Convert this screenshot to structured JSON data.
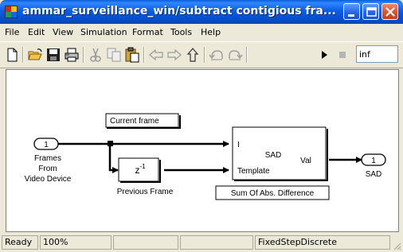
{
  "window": {
    "title": "ammar_surveillance_win/subtract contigious fra...",
    "title_icon": "simulink-model-icon",
    "buttons": [
      "minimize-icon",
      "maximize-icon",
      "close-icon"
    ]
  },
  "menu": {
    "items": [
      "File",
      "Edit",
      "View",
      "Simulation",
      "Format",
      "Tools",
      "Help"
    ]
  },
  "toolbar": {
    "icons": [
      "new-icon",
      "open-icon",
      "save-icon",
      "print-icon",
      "cut-icon",
      "copy-icon",
      "paste-icon",
      "back-icon",
      "forward-icon",
      "up-icon",
      "undo-icon",
      "redo-icon",
      "start-simulation-icon",
      "stop-simulation-icon"
    ],
    "stop_time": "inf"
  },
  "diagram": {
    "inport": {
      "number": "1",
      "label_lines": [
        "Frames",
        "From",
        "Video Device"
      ]
    },
    "current_frame_label": "Current frame",
    "delay": {
      "label": "Previous Frame"
    },
    "sad_block": {
      "title": "SAD",
      "in1": "I",
      "in2": "Template",
      "out": "Val",
      "caption": "Sum Of Abs. Difference"
    },
    "outport": {
      "number": "1",
      "label": "SAD"
    }
  },
  "status": {
    "state": "Ready",
    "zoom": "100%",
    "solver": "FixedStepDiscrete"
  },
  "colors": {
    "titlebar": "#0551d4",
    "chrome": "#ece9d8",
    "close_button": "#d9532d"
  }
}
